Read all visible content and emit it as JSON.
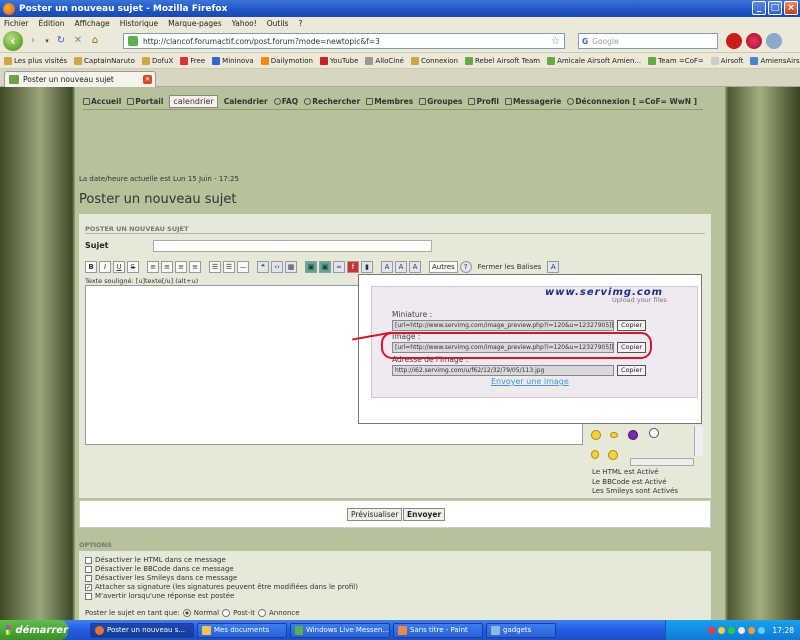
{
  "window": {
    "title": "Poster un nouveau sujet - Mozilla Firefox"
  },
  "menubar": [
    "Fichier",
    "Édition",
    "Affichage",
    "Historique",
    "Marque-pages",
    "Yahoo!",
    "Outils",
    "?"
  ],
  "navbar": {
    "url": "http://clancof.forumactif.com/post.forum?mode=newtopic&f=3",
    "search_placeholder": "Google",
    "search_engine": "G"
  },
  "bookmarks": [
    "Les plus visités",
    "CaptainNaruto",
    "DofuX",
    "Free",
    "Mininova",
    "Dailymotion",
    "YouTube",
    "AlloCiné",
    "Connexion",
    "Rebel Airsoft Team",
    "Amicale Airsoft Amien...",
    "Team =CoF=",
    "Airsoft",
    "AmiensAirsoft: FPS - a..."
  ],
  "tabs": [
    {
      "label": "Poster un nouveau sujet"
    }
  ],
  "forum": {
    "nav": [
      "Accueil",
      "Portail",
      "calendrier",
      "Calendrier",
      "FAQ",
      "Rechercher",
      "Membres",
      "Groupes",
      "Profil",
      "Messagerie",
      "Déconnexion [ =CoF= WwN ]"
    ],
    "datetime": "La date/heure actuelle est Lun 15 Juin - 17:25",
    "page_title": "Poster un nouveau sujet",
    "form_header": "POSTER UN NOUVEAU SUJET",
    "subject_label": "Sujet",
    "toolbar": {
      "bold": "B",
      "italic": "I",
      "underline": "U",
      "strike": "S",
      "autres": "Autres",
      "fermer": "Fermer les Balises"
    },
    "hint": "Texte souligné: [u]texte[/u] (alt+u)",
    "info": [
      "Le HTML est Activé",
      "Le BBCode est Activé",
      "Les Smileys sont Activés"
    ],
    "buttons": {
      "preview": "Prévisualiser",
      "send": "Envoyer"
    },
    "options_header": "OPTIONS",
    "options": [
      {
        "label": "Désactiver le HTML dans ce message",
        "checked": false
      },
      {
        "label": "Désactiver le BBCode dans ce message",
        "checked": false
      },
      {
        "label": "Désactiver les Smileys dans ce message",
        "checked": false
      },
      {
        "label": "Attacher sa signature (les signatures peuvent être modifiées dans le profil)",
        "checked": true
      },
      {
        "label": "M'avertir lorsqu'une réponse est postée",
        "checked": false
      }
    ],
    "post_as_label": "Poster le sujet en tant que:",
    "post_as": [
      "Normal",
      "Post-it",
      "Annonce"
    ]
  },
  "servimg": {
    "logo": "www.servimg.com",
    "tagline": "Upload your files",
    "miniature_label": "Miniature :",
    "miniature_value": "[url=http://www.servimg.com/image_preview.php?i=120&u=12327905][im",
    "image_label": "Image :",
    "image_value": "[url=http://www.servimg.com/image_preview.php?i=120&u=12327905][im",
    "address_label": "Adresse de l'image :",
    "address_value": "http://i62.servimg.com/u/f62/12/32/79/05/113.jpg",
    "copy": "Copier",
    "envoyer": "Envoyer une image",
    "highlight_color": "#d8152b"
  },
  "taskbar": {
    "start": "démarrer",
    "tasks": [
      "Poster un nouveau s...",
      "Mes documents",
      "Windows Live Messen...",
      "Sans titre - Paint"
    ],
    "gadgets": "gadgets",
    "clock": "17:28"
  }
}
